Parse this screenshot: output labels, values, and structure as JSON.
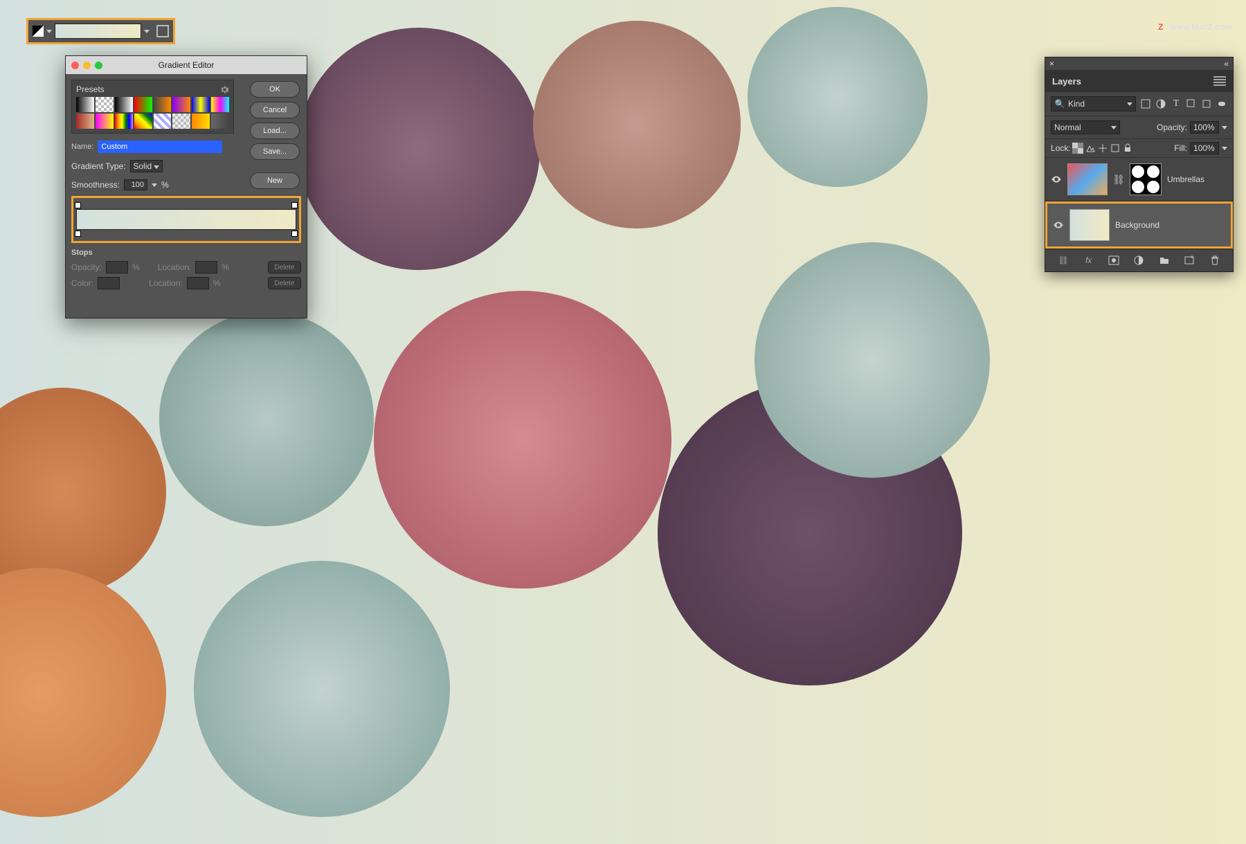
{
  "watermark": {
    "z": "Z",
    "text": "www.MacZ.com"
  },
  "gradient_editor": {
    "title": "Gradient Editor",
    "presets_label": "Presets",
    "buttons": {
      "ok": "OK",
      "cancel": "Cancel",
      "load": "Load...",
      "save": "Save...",
      "new": "New"
    },
    "name_label": "Name:",
    "name_value": "Custom",
    "gtype_label": "Gradient Type:",
    "gtype_value": "Solid",
    "smooth_label": "Smoothness:",
    "smooth_value": "100",
    "smooth_unit": "%",
    "stops_heading": "Stops",
    "opacity_label": "Opacity:",
    "location_label": "Location:",
    "color_label": "Color:",
    "pct": "%",
    "delete": "Delete",
    "preset_colors": [
      "linear-gradient(to right,#000,#fff)",
      "repeating-conic-gradient(#bbb 0 25%,#fff 0 50%) 0 0/8px 8px",
      "linear-gradient(to right,#000,#fff)",
      "linear-gradient(to right,#f00,#0f0)",
      "linear-gradient(to right,#444,#f80)",
      "linear-gradient(to right,#80f,#f80)",
      "linear-gradient(to right,#00f,#ff0,#00f)",
      "linear-gradient(to right,#ff0,#f0f,#0ff)",
      "linear-gradient(to right,#a52a2a,#deb887)",
      "linear-gradient(to right,#f0f,#ff0)",
      "linear-gradient(to right,red,orange,yellow,green,blue,violet)",
      "linear-gradient(45deg,red,orange,yellow,green,blue)",
      "repeating-linear-gradient(45deg,#aaf 0 4px,#fff 4px 8px)",
      "repeating-conic-gradient(#bbb 0 25%,#eee 0 50%) 0 0/8px 8px",
      "linear-gradient(to right,#f80,#fd0)",
      "linear-gradient(to right,#666,transparent)"
    ]
  },
  "layers_panel": {
    "title": "Layers",
    "kind_label": "Kind",
    "blend_mode": "Normal",
    "opacity_label": "Opacity:",
    "opacity_value": "100%",
    "lock_label": "Lock:",
    "fill_label": "Fill:",
    "fill_value": "100%",
    "layers": [
      {
        "name": "Umbrellas"
      },
      {
        "name": "Background"
      }
    ]
  },
  "icons": {
    "search": "🔍"
  }
}
